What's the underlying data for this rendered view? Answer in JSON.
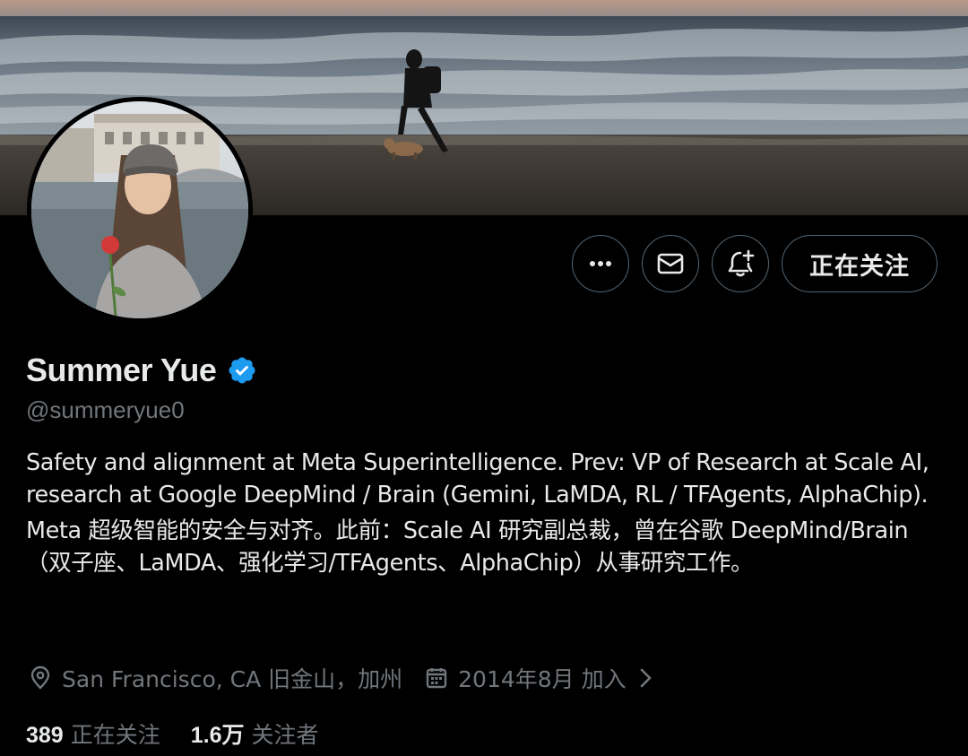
{
  "profile": {
    "display_name": "Summer Yue",
    "handle": "@summeryue0",
    "verified": true,
    "verified_color": "#1d9bf0",
    "bio_en": "Safety and alignment at Meta Superintelligence. Prev: VP of Research at Scale AI, research at Google DeepMind / Brain (Gemini, LaMDA, RL / TFAgents, AlphaChip).",
    "bio_zh": "Meta 超级智能的安全与对齐。此前：Scale AI 研究副总裁，曾在谷歌 DeepMind/Brain（双子座、LaMDA、强化学习/TFAgents、AlphaChip）从事研究工作。",
    "location": "San Francisco, CA  旧金山，加州",
    "joined": "2014年8月 加入"
  },
  "actions": {
    "more_icon": "more-horizontal-icon",
    "message_icon": "envelope-icon",
    "notify_icon": "bell-plus-icon",
    "follow_label": "正在关注"
  },
  "stats": {
    "following_count": "389",
    "following_label": "正在关注",
    "followers_count": "1.6万",
    "followers_label": "关注者"
  },
  "colors": {
    "background": "#000000",
    "primary_text": "#e7e9ea",
    "secondary_text": "#71767b",
    "border": "#536471"
  },
  "icons": {
    "location": "map-pin-icon",
    "calendar": "calendar-icon",
    "chevron": "chevron-right-icon"
  }
}
